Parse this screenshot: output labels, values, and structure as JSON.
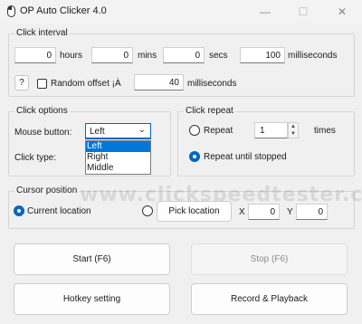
{
  "window": {
    "title": "OP Auto Clicker 4.0",
    "controls": {
      "minimize": "—",
      "maximize": "☐",
      "close": "✕"
    }
  },
  "click_interval": {
    "label": "Click interval",
    "hours": {
      "value": "0",
      "unit": "hours"
    },
    "mins": {
      "value": "0",
      "unit": "mins"
    },
    "secs": {
      "value": "0",
      "unit": "secs"
    },
    "milliseconds": {
      "value": "100",
      "unit": "milliseconds"
    },
    "help_label": "?",
    "random_offset": {
      "label": "Random offset ¡À",
      "checked": false,
      "value": "40",
      "unit": "milliseconds"
    }
  },
  "click_options": {
    "label": "Click options",
    "mouse_button_label": "Mouse button:",
    "mouse_button_value": "Left",
    "mouse_button_options": [
      "Left",
      "Right",
      "Middle"
    ],
    "click_type_label": "Click type:"
  },
  "click_repeat": {
    "label": "Click repeat",
    "repeat_label": "Repeat",
    "repeat_value": "1",
    "times_label": "times",
    "until_stopped_label": "Repeat until stopped",
    "selected": "until_stopped"
  },
  "cursor_position": {
    "label": "Cursor position",
    "current_location_label": "Current location",
    "pick_location_label": "Pick location",
    "x_label": "X",
    "x_value": "0",
    "y_label": "Y",
    "y_value": "0",
    "selected": "current"
  },
  "buttons": {
    "start": "Start (F6)",
    "stop": "Stop (F6)",
    "hotkey": "Hotkey setting",
    "record": "Record & Playback"
  },
  "watermark": "www.clickspeedtester.com",
  "colors": {
    "accent": "#0067c0",
    "selection": "#0078d7"
  }
}
